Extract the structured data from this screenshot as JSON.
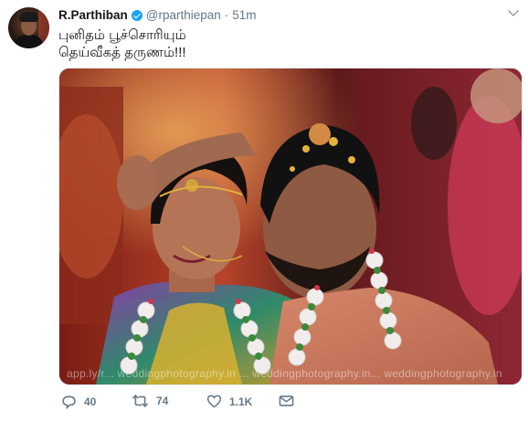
{
  "tweet": {
    "author_name": "R.Parthiban",
    "handle": "@rparthiepan",
    "separator": "·",
    "time": "51m",
    "text_line_1": "புனிதம் பூச்சொரியும்",
    "text_line_2": "தெய்வீகத் தருணம்!!!",
    "photo_watermark": "app.ly/r... weddingphotography.in ... weddingphotography.in... weddingphotography.in"
  },
  "actions": {
    "reply_count": "40",
    "retweet_count": "74",
    "like_count": "1.1K"
  },
  "colors": {
    "verified": "#1da1f2",
    "meta_text": "#657786",
    "text": "#14171a"
  },
  "icons": [
    "verified-icon",
    "chevron-down-icon",
    "reply-icon",
    "retweet-icon",
    "heart-icon",
    "direct-message-icon"
  ]
}
